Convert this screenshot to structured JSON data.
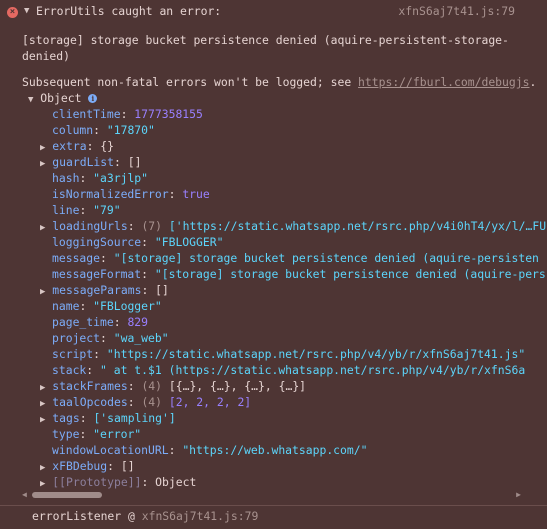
{
  "header": {
    "title": "ErrorUtils caught an error:",
    "source": "xfnS6aj7t41.js:79"
  },
  "message_line1": "[storage] storage bucket persistence denied (aquire-persistent-storage-",
  "message_line2": "denied)",
  "subsequent": {
    "text": "Subsequent non-fatal errors won't be logged; see ",
    "link": "https://fburl.com/debugjs",
    "end": "."
  },
  "object": {
    "label": "Object"
  },
  "props": {
    "clientTime": {
      "key": "clientTime",
      "value": "1777358155"
    },
    "column": {
      "key": "column",
      "value": "\"17870\""
    },
    "extra": {
      "key": "extra",
      "value": "{}"
    },
    "guardList": {
      "key": "guardList",
      "value": "[]"
    },
    "hash": {
      "key": "hash",
      "value": "\"a3rjlp\""
    },
    "isNormalizedError": {
      "key": "isNormalizedError",
      "value": "true"
    },
    "line": {
      "key": "line",
      "value": "\"79\""
    },
    "loadingUrls": {
      "key": "loadingUrls",
      "count": "(7)",
      "value": "['https://static.whatsapp.net/rsrc.php/v4i0hT4/yx/l/…FU"
    },
    "loggingSource": {
      "key": "loggingSource",
      "value": "\"FBLOGGER\""
    },
    "message": {
      "key": "message",
      "value": "\"[storage] storage bucket persistence denied (aquire-persisten"
    },
    "messageFormat": {
      "key": "messageFormat",
      "value": "\"[storage] storage bucket persistence denied (aquire-pers"
    },
    "messageParams": {
      "key": "messageParams",
      "value": "[]"
    },
    "name": {
      "key": "name",
      "value": "\"FBLogger\""
    },
    "page_time": {
      "key": "page_time",
      "value": "829"
    },
    "project": {
      "key": "project",
      "value": "\"wa_web\""
    },
    "script": {
      "key": "script",
      "value": "\"https://static.whatsapp.net/rsrc.php/v4/yb/r/xfnS6aj7t41.js\""
    },
    "stack": {
      "key": "stack",
      "value": "\"    at t.$1 (https://static.whatsapp.net/rsrc.php/v4/yb/r/xfnS6a"
    },
    "stackFrames": {
      "key": "stackFrames",
      "count": "(4)",
      "value": "[{…}, {…}, {…}, {…}]"
    },
    "taalOpcodes": {
      "key": "taalOpcodes",
      "count": "(4)",
      "value": "[2, 2, 2, 2]"
    },
    "tags": {
      "key": "tags",
      "value": "['sampling']"
    },
    "type": {
      "key": "type",
      "value": "\"error\""
    },
    "windowLocationURL": {
      "key": "windowLocationURL",
      "value": "\"https://web.whatsapp.com/\""
    },
    "xFBDebug": {
      "key": "xFBDebug",
      "value": "[]"
    },
    "prototype": {
      "key": "[[Prototype]]",
      "value": "Object"
    }
  },
  "footer": {
    "listener": "errorListener @ ",
    "source": "xfnS6aj7t41.js:79"
  }
}
